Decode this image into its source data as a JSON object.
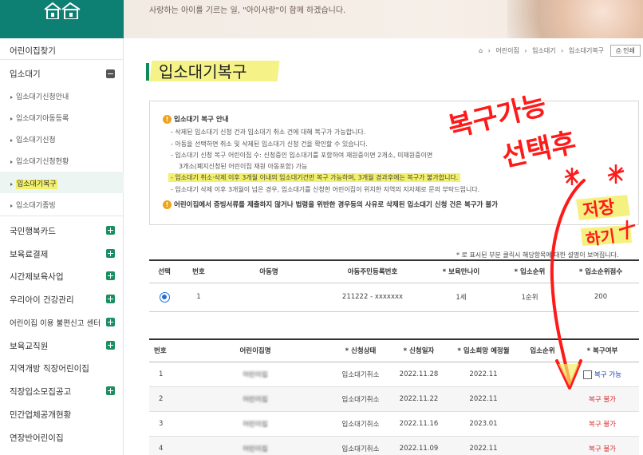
{
  "header": {
    "logo": "house-logo",
    "banner_text": "사랑하는 아이를 기르는 일, \"아이사랑\"이 함께 하겠습니다."
  },
  "sidebar": {
    "items": [
      {
        "label": "어린이집찾기"
      },
      {
        "label": "입소대기",
        "expanded": true
      },
      {
        "label": "국민행복카드"
      },
      {
        "label": "보육료결제"
      },
      {
        "label": "시간제보육사업"
      },
      {
        "label": "우리아이 건강관리"
      },
      {
        "label": "어린이집 이용 불편신고 센터"
      },
      {
        "label": "보육교직원"
      },
      {
        "label": "지역개방 직장어린이집"
      },
      {
        "label": "직장입소모집공고"
      },
      {
        "label": "민간업체공개현황"
      },
      {
        "label": "연장반어린이집"
      }
    ],
    "sub_items": [
      {
        "label": "입소대기신청안내"
      },
      {
        "label": "입소대기아동등록"
      },
      {
        "label": "입소대기신청"
      },
      {
        "label": "입소대기신청현황"
      },
      {
        "label": "입소대기복구",
        "active": true
      },
      {
        "label": "입소대기종빙"
      }
    ]
  },
  "breadcrumb": {
    "home_icon": "home-icon",
    "items": [
      "어린이집",
      "입소대기",
      "입소대기복구"
    ],
    "print_label": "인쇄"
  },
  "page": {
    "title": "입소대기복구"
  },
  "notice": {
    "heading": "입소대기 복구 안내",
    "lines": [
      "- 삭제된 입소대기 신청 건과 입소대기 취소 건에 대해 복구가 가능합니다.",
      "- 아동을 선택하면 취소 및 삭제된 입소대기 신청 건을 확인할 수 있습니다.",
      "- 입소대기 신청 복구 어린이집 수: 신청중인 입소대기를 포함하여 재원중이면 2개소, 미재원중이면",
      "3개소(폐지신청된 어린이집 재원 아동포함) 가능",
      "- 입소대기 취소·삭제 이후 3개월 이내의 입소대기건만 복구 가능하며, 3개월 경과후에는 복구가 불가합니다.",
      "- 입소대기 삭제 이후 3개월이 넘은 경우, 입소대기를 신청한 어린이집이 위치한 지역의 지자체로 문의 부탁드립니다."
    ],
    "footer": "어린이집에서 증빙서류를 제출하지 않거나 법령을 위반한 경우등의 사유로 삭제된 입소대기 신청 건은 복구가 불가"
  },
  "help_note": "* 로 표시된 부분 클릭시 해당항목에 대한 설명이 보여집니다.",
  "child_table": {
    "headers": [
      "선택",
      "번호",
      "아동명",
      "아동주민등록번호",
      "* 보육만나이",
      "* 입소순위",
      "* 입소순위점수"
    ],
    "rows": [
      {
        "no": "1",
        "name": "",
        "rrn": "211222 - xxxxxxx",
        "age": "1세",
        "rank": "1순위",
        "score": "200"
      }
    ]
  },
  "history_table": {
    "headers": [
      "번호",
      "어린이집명",
      "* 신청상태",
      "* 신청일자",
      "* 입소희망 예정월",
      "입소순위",
      "* 복구여부"
    ],
    "rows": [
      {
        "no": "1",
        "name": "어린이집",
        "state": "입소대기취소",
        "date": "2022.11.28",
        "month": "2022.11",
        "restore": "복구 가능",
        "ok": true
      },
      {
        "no": "2",
        "name": "어린이집",
        "state": "입소대기취소",
        "date": "2022.11.22",
        "month": "2022.11",
        "restore": "복구 불가",
        "ok": false
      },
      {
        "no": "3",
        "name": "어린이집",
        "state": "입소대기취소",
        "date": "2022.11.16",
        "month": "2023.01",
        "restore": "복구 불가",
        "ok": false
      },
      {
        "no": "4",
        "name": "어린이집",
        "state": "입소대기취소",
        "date": "2022.11.09",
        "month": "2022.11",
        "restore": "복구 불가",
        "ok": false
      }
    ]
  },
  "annotation": {
    "line1": "복구가능",
    "line2": "선택후",
    "line3": "저장",
    "line4": "하기",
    "color": "#ff1a1a"
  }
}
